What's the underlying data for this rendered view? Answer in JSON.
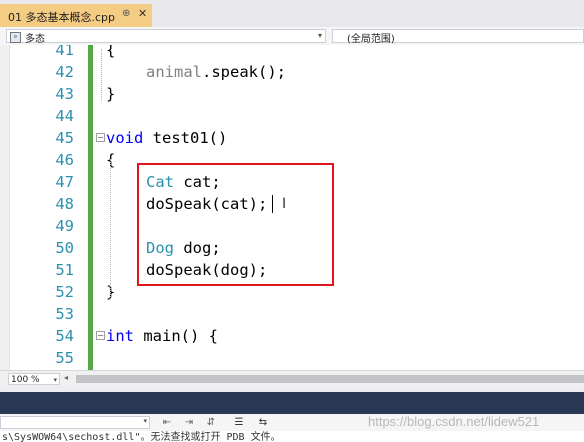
{
  "tab": {
    "title": "01 多态基本概念.cpp",
    "pin": "⊕",
    "close": "✕"
  },
  "navbar": {
    "scope": "多态",
    "range": "(全局范围)"
  },
  "code": [
    {
      "num": "41",
      "tokens": [
        {
          "t": "{",
          "c": "plain"
        }
      ]
    },
    {
      "num": "42",
      "tokens": [
        {
          "t": "animal",
          "c": "id"
        },
        {
          "t": ".speak();",
          "c": "plain"
        }
      ]
    },
    {
      "num": "43",
      "tokens": [
        {
          "t": "}",
          "c": "plain"
        }
      ]
    },
    {
      "num": "44",
      "tokens": []
    },
    {
      "num": "45",
      "tokens": [
        {
          "t": "void",
          "c": "kw"
        },
        {
          "t": " test01()",
          "c": "plain"
        }
      ]
    },
    {
      "num": "46",
      "tokens": [
        {
          "t": "{",
          "c": "plain"
        }
      ]
    },
    {
      "num": "47",
      "tokens": [
        {
          "t": "Cat",
          "c": "type"
        },
        {
          "t": " cat;",
          "c": "plain"
        }
      ]
    },
    {
      "num": "48",
      "tokens": [
        {
          "t": "doSpeak(cat);",
          "c": "plain"
        }
      ]
    },
    {
      "num": "49",
      "tokens": []
    },
    {
      "num": "50",
      "tokens": [
        {
          "t": "Dog",
          "c": "type"
        },
        {
          "t": " dog;",
          "c": "plain"
        }
      ]
    },
    {
      "num": "51",
      "tokens": [
        {
          "t": "doSpeak(dog);",
          "c": "plain"
        }
      ]
    },
    {
      "num": "52",
      "tokens": [
        {
          "t": "}",
          "c": "plain"
        }
      ]
    },
    {
      "num": "53",
      "tokens": []
    },
    {
      "num": "54",
      "tokens": [
        {
          "t": "int",
          "c": "kw"
        },
        {
          "t": " main() {",
          "c": "plain"
        }
      ]
    },
    {
      "num": "55",
      "tokens": []
    }
  ],
  "zoom": "100 %",
  "output_text": "s\\SysWOW64\\sechost.dll\"。无法查找或打开 PDB 文件。",
  "watermark": "https://blog.csdn.net/lidew521",
  "icons": {
    "tab_pin": "pin-icon",
    "tab_close": "close-icon",
    "fold": "fold-icon",
    "ibeam": "text-cursor-icon"
  }
}
